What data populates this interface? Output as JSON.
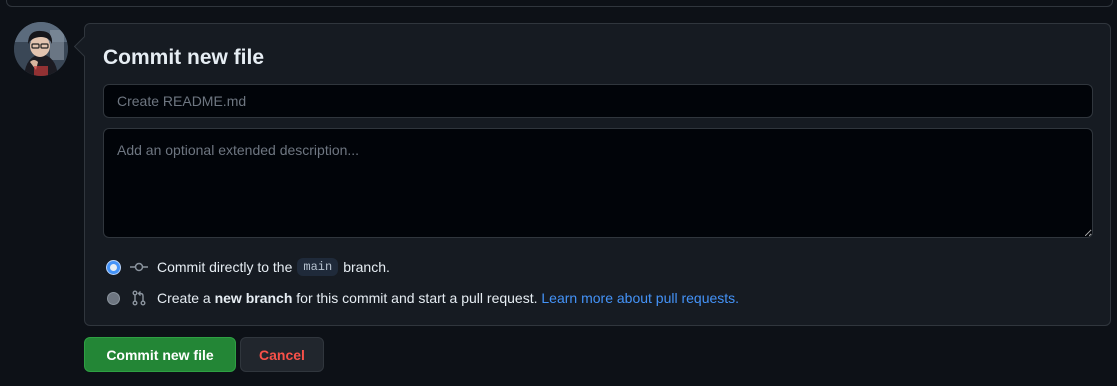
{
  "commit_panel": {
    "title": "Commit new file",
    "summary_placeholder": "Create README.md",
    "summary_value": "",
    "description_placeholder": "Add an optional extended description...",
    "description_value": "",
    "options": {
      "direct": {
        "text_before": "Commit directly to the",
        "branch_name": "main",
        "text_after": "branch.",
        "selected": true
      },
      "new_branch": {
        "text_before": "Create a",
        "bold_text": "new branch",
        "text_after": "for this commit and start a pull request.",
        "link_text": "Learn more about pull requests.",
        "selected": false
      }
    }
  },
  "actions": {
    "commit_label": "Commit new file",
    "cancel_label": "Cancel"
  },
  "icons": {
    "avatar": "user-avatar",
    "commit": "git-commit-icon",
    "pull_request": "git-pull-request-icon"
  },
  "colors": {
    "background": "#0d1117",
    "panel": "#161b22",
    "border": "#30363d",
    "accent_green": "#238636",
    "danger_red": "#f85149",
    "link_blue": "#4493f8"
  }
}
